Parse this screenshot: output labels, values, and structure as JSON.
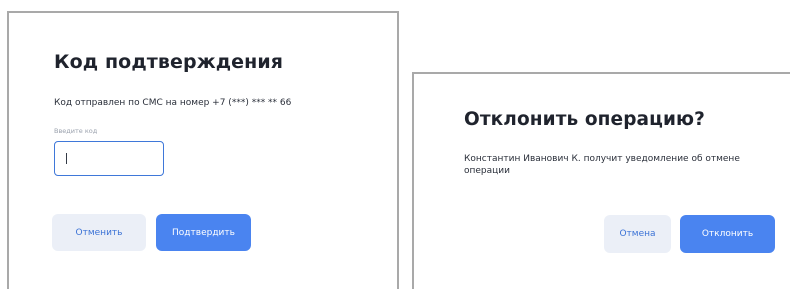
{
  "confirm_dialog": {
    "title": "Код подтверждения",
    "message": "Код отправлен по СМС на номер +7 (***) *** ** 66",
    "code_field": {
      "label": "Введите код",
      "value": ""
    },
    "cancel_label": "Отменить",
    "confirm_label": "Подтвердить"
  },
  "decline_dialog": {
    "title": "Отклонить операцию?",
    "message": "Константин Иванович К. получит уведомление об отмене операции",
    "cancel_label": "Отмена",
    "decline_label": "Отклонить"
  },
  "colors": {
    "accent": "#4a84f0",
    "input_focus_border": "#3f78d9",
    "secondary_button_bg": "#ebeff7",
    "title_text": "#1f232d"
  }
}
